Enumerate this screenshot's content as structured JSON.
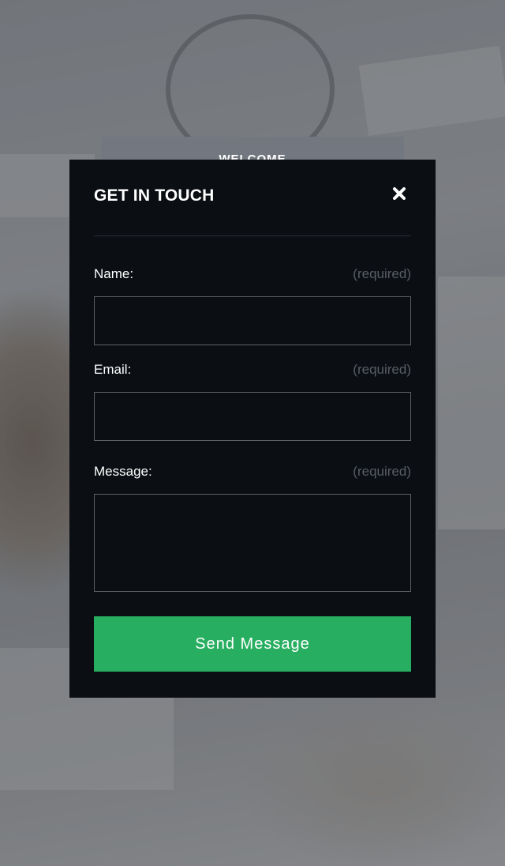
{
  "background": {
    "tab_label": "WELCOME"
  },
  "modal": {
    "title": "GET IN TOUCH",
    "close_icon": "close-icon",
    "fields": {
      "name": {
        "label": "Name:",
        "required": "(required)",
        "value": ""
      },
      "email": {
        "label": "Email:",
        "required": "(required)",
        "value": ""
      },
      "message": {
        "label": "Message:",
        "required": "(required)",
        "value": ""
      }
    },
    "submit_label": "Send Message"
  },
  "colors": {
    "modal_bg": "#0b0f14",
    "accent": "#27ae60",
    "required_text": "#585d63"
  }
}
